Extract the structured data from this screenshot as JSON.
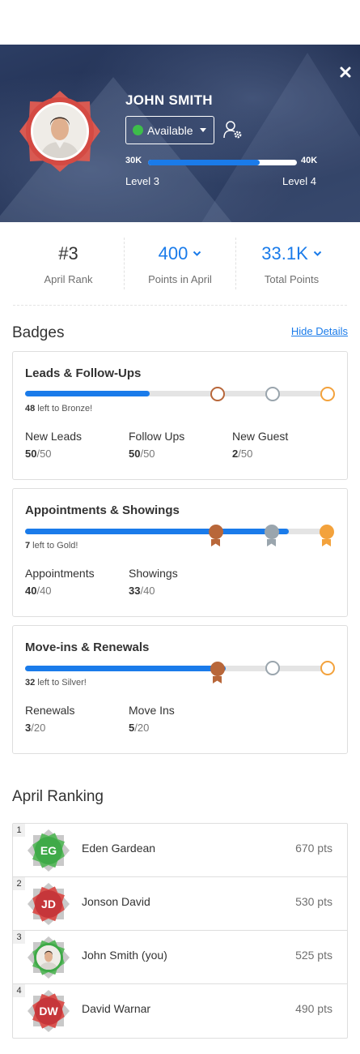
{
  "profile": {
    "name": "JOHN SMITH",
    "status": "Available",
    "xp_start": "30K",
    "xp_end": "40K",
    "xp_progress": 0.75,
    "level_current": "Level 3",
    "level_next": "Level 4"
  },
  "stats": [
    {
      "value": "#3",
      "label": "April Rank"
    },
    {
      "value": "400",
      "label": "Points in April"
    },
    {
      "value": "33.1K",
      "label": "Total Points"
    }
  ],
  "badges": {
    "title": "Badges",
    "hide_link": "Hide Details",
    "cards": [
      {
        "title": "Leads & Follow-Ups",
        "progress": 0.41,
        "left_count": "48",
        "left_text": " left to Bronze!",
        "metrics": [
          {
            "label": "New Leads",
            "done": "50",
            "total": "/50"
          },
          {
            "label": "Follow Ups",
            "done": "50",
            "total": "/50"
          },
          {
            "label": "New Guest",
            "done": "2",
            "total": "/50"
          }
        ]
      },
      {
        "title": "Appointments & Showings",
        "progress": 0.87,
        "left_count": "7",
        "left_text": " left to Gold!",
        "metrics": [
          {
            "label": "Appointments",
            "done": "40",
            "total": "/40"
          },
          {
            "label": "Showings",
            "done": "33",
            "total": "/40"
          }
        ]
      },
      {
        "title": "Move-ins & Renewals",
        "progress": 0.66,
        "left_count": "32",
        "left_text": " left to Silver!",
        "metrics": [
          {
            "label": "Renewals",
            "done": "3",
            "total": "/20"
          },
          {
            "label": "Move Ins",
            "done": "5",
            "total": "/20"
          }
        ]
      }
    ]
  },
  "ranking": {
    "title": "April Ranking",
    "rows": [
      {
        "rank": "1",
        "initials": "EG",
        "name": "Eden Gardean",
        "points": "670 pts"
      },
      {
        "rank": "2",
        "initials": "JD",
        "name": "Jonson David",
        "points": "530 pts"
      },
      {
        "rank": "3",
        "name": "John Smith (you)",
        "points": "525 pts"
      },
      {
        "rank": "4",
        "initials": "DW",
        "name": "David Warnar",
        "points": "490 pts"
      }
    ]
  },
  "colors": {
    "accent_blue": "#1a7bea",
    "available_green": "#3dbd4a",
    "bronze": "#b8673a",
    "silver": "#9aa5ad",
    "gold": "#f3a23c",
    "badge_green": "#3faa48",
    "badge_red": "#c6363a"
  }
}
